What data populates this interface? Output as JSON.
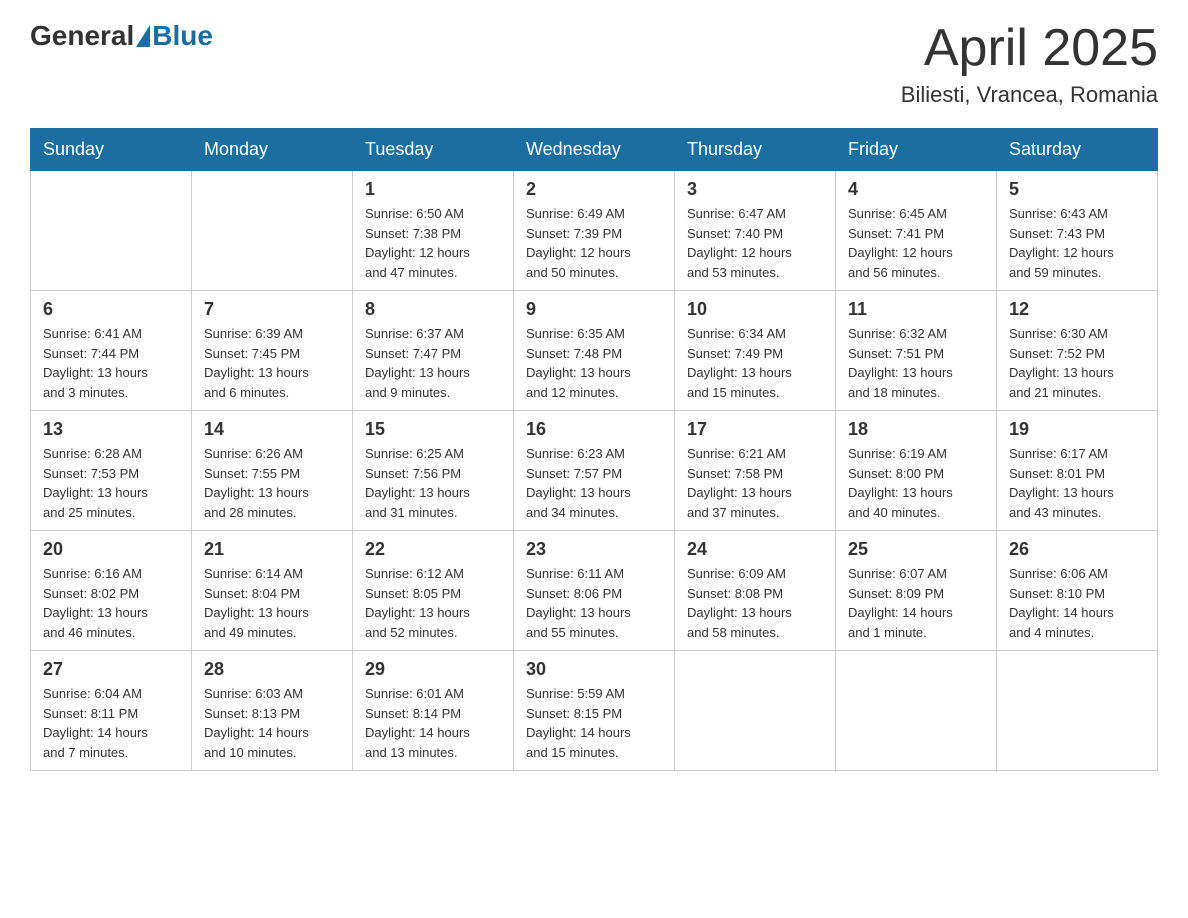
{
  "logo": {
    "general": "General",
    "blue": "Blue"
  },
  "header": {
    "title": "April 2025",
    "location": "Biliesti, Vrancea, Romania"
  },
  "weekdays": [
    "Sunday",
    "Monday",
    "Tuesday",
    "Wednesday",
    "Thursday",
    "Friday",
    "Saturday"
  ],
  "weeks": [
    [
      {
        "day": "",
        "info": ""
      },
      {
        "day": "",
        "info": ""
      },
      {
        "day": "1",
        "info": "Sunrise: 6:50 AM\nSunset: 7:38 PM\nDaylight: 12 hours\nand 47 minutes."
      },
      {
        "day": "2",
        "info": "Sunrise: 6:49 AM\nSunset: 7:39 PM\nDaylight: 12 hours\nand 50 minutes."
      },
      {
        "day": "3",
        "info": "Sunrise: 6:47 AM\nSunset: 7:40 PM\nDaylight: 12 hours\nand 53 minutes."
      },
      {
        "day": "4",
        "info": "Sunrise: 6:45 AM\nSunset: 7:41 PM\nDaylight: 12 hours\nand 56 minutes."
      },
      {
        "day": "5",
        "info": "Sunrise: 6:43 AM\nSunset: 7:43 PM\nDaylight: 12 hours\nand 59 minutes."
      }
    ],
    [
      {
        "day": "6",
        "info": "Sunrise: 6:41 AM\nSunset: 7:44 PM\nDaylight: 13 hours\nand 3 minutes."
      },
      {
        "day": "7",
        "info": "Sunrise: 6:39 AM\nSunset: 7:45 PM\nDaylight: 13 hours\nand 6 minutes."
      },
      {
        "day": "8",
        "info": "Sunrise: 6:37 AM\nSunset: 7:47 PM\nDaylight: 13 hours\nand 9 minutes."
      },
      {
        "day": "9",
        "info": "Sunrise: 6:35 AM\nSunset: 7:48 PM\nDaylight: 13 hours\nand 12 minutes."
      },
      {
        "day": "10",
        "info": "Sunrise: 6:34 AM\nSunset: 7:49 PM\nDaylight: 13 hours\nand 15 minutes."
      },
      {
        "day": "11",
        "info": "Sunrise: 6:32 AM\nSunset: 7:51 PM\nDaylight: 13 hours\nand 18 minutes."
      },
      {
        "day": "12",
        "info": "Sunrise: 6:30 AM\nSunset: 7:52 PM\nDaylight: 13 hours\nand 21 minutes."
      }
    ],
    [
      {
        "day": "13",
        "info": "Sunrise: 6:28 AM\nSunset: 7:53 PM\nDaylight: 13 hours\nand 25 minutes."
      },
      {
        "day": "14",
        "info": "Sunrise: 6:26 AM\nSunset: 7:55 PM\nDaylight: 13 hours\nand 28 minutes."
      },
      {
        "day": "15",
        "info": "Sunrise: 6:25 AM\nSunset: 7:56 PM\nDaylight: 13 hours\nand 31 minutes."
      },
      {
        "day": "16",
        "info": "Sunrise: 6:23 AM\nSunset: 7:57 PM\nDaylight: 13 hours\nand 34 minutes."
      },
      {
        "day": "17",
        "info": "Sunrise: 6:21 AM\nSunset: 7:58 PM\nDaylight: 13 hours\nand 37 minutes."
      },
      {
        "day": "18",
        "info": "Sunrise: 6:19 AM\nSunset: 8:00 PM\nDaylight: 13 hours\nand 40 minutes."
      },
      {
        "day": "19",
        "info": "Sunrise: 6:17 AM\nSunset: 8:01 PM\nDaylight: 13 hours\nand 43 minutes."
      }
    ],
    [
      {
        "day": "20",
        "info": "Sunrise: 6:16 AM\nSunset: 8:02 PM\nDaylight: 13 hours\nand 46 minutes."
      },
      {
        "day": "21",
        "info": "Sunrise: 6:14 AM\nSunset: 8:04 PM\nDaylight: 13 hours\nand 49 minutes."
      },
      {
        "day": "22",
        "info": "Sunrise: 6:12 AM\nSunset: 8:05 PM\nDaylight: 13 hours\nand 52 minutes."
      },
      {
        "day": "23",
        "info": "Sunrise: 6:11 AM\nSunset: 8:06 PM\nDaylight: 13 hours\nand 55 minutes."
      },
      {
        "day": "24",
        "info": "Sunrise: 6:09 AM\nSunset: 8:08 PM\nDaylight: 13 hours\nand 58 minutes."
      },
      {
        "day": "25",
        "info": "Sunrise: 6:07 AM\nSunset: 8:09 PM\nDaylight: 14 hours\nand 1 minute."
      },
      {
        "day": "26",
        "info": "Sunrise: 6:06 AM\nSunset: 8:10 PM\nDaylight: 14 hours\nand 4 minutes."
      }
    ],
    [
      {
        "day": "27",
        "info": "Sunrise: 6:04 AM\nSunset: 8:11 PM\nDaylight: 14 hours\nand 7 minutes."
      },
      {
        "day": "28",
        "info": "Sunrise: 6:03 AM\nSunset: 8:13 PM\nDaylight: 14 hours\nand 10 minutes."
      },
      {
        "day": "29",
        "info": "Sunrise: 6:01 AM\nSunset: 8:14 PM\nDaylight: 14 hours\nand 13 minutes."
      },
      {
        "day": "30",
        "info": "Sunrise: 5:59 AM\nSunset: 8:15 PM\nDaylight: 14 hours\nand 15 minutes."
      },
      {
        "day": "",
        "info": ""
      },
      {
        "day": "",
        "info": ""
      },
      {
        "day": "",
        "info": ""
      }
    ]
  ]
}
